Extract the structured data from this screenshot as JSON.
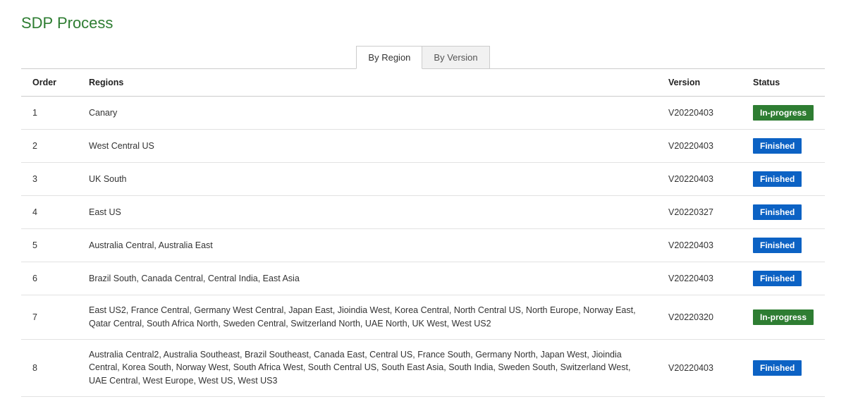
{
  "title": "SDP Process",
  "tabs": {
    "by_region": "By Region",
    "by_version": "By Version",
    "active": "by_region"
  },
  "columns": {
    "order": "Order",
    "regions": "Regions",
    "version": "Version",
    "status": "Status"
  },
  "status_labels": {
    "in_progress": "In-progress",
    "finished": "Finished"
  },
  "status_colors": {
    "in_progress": "#2e7d32",
    "finished": "#0c62c4"
  },
  "rows": [
    {
      "order": "1",
      "regions": "Canary",
      "version": "V20220403",
      "status": "in_progress"
    },
    {
      "order": "2",
      "regions": "West Central US",
      "version": "V20220403",
      "status": "finished"
    },
    {
      "order": "3",
      "regions": "UK South",
      "version": "V20220403",
      "status": "finished"
    },
    {
      "order": "4",
      "regions": "East US",
      "version": "V20220327",
      "status": "finished"
    },
    {
      "order": "5",
      "regions": "Australia Central, Australia East",
      "version": "V20220403",
      "status": "finished"
    },
    {
      "order": "6",
      "regions": "Brazil South, Canada Central, Central India, East Asia",
      "version": "V20220403",
      "status": "finished"
    },
    {
      "order": "7",
      "regions": "East US2, France Central, Germany West Central, Japan East, Jioindia West, Korea Central, North Central US, North Europe, Norway East, Qatar Central, South Africa North, Sweden Central, Switzerland North, UAE North, UK West, West US2",
      "version": "V20220320",
      "status": "in_progress"
    },
    {
      "order": "8",
      "regions": "Australia Central2, Australia Southeast, Brazil Southeast, Canada East, Central US, France South, Germany North, Japan West, Jioindia Central, Korea South, Norway West, South Africa West, South Central US, South East Asia, South India, Sweden South, Switzerland West, UAE Central, West Europe, West US, West US3",
      "version": "V20220403",
      "status": "finished"
    }
  ]
}
